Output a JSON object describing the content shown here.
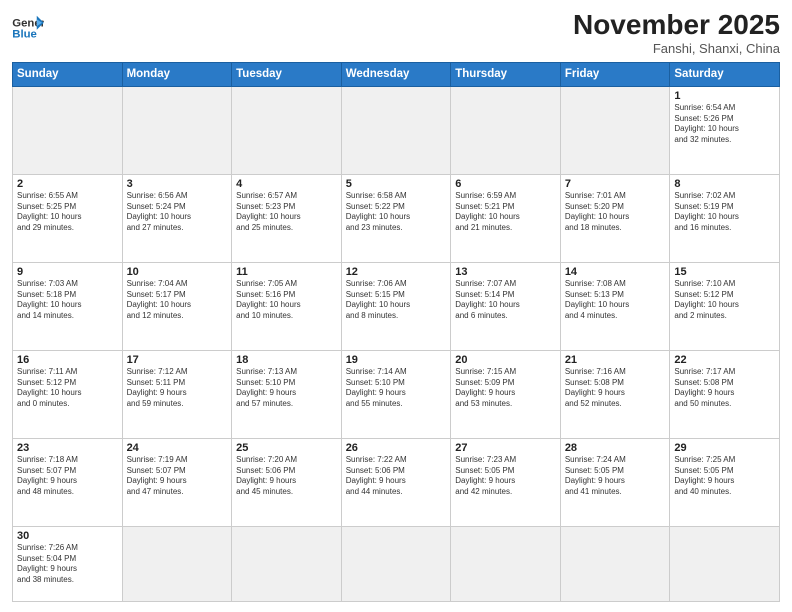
{
  "header": {
    "logo_general": "General",
    "logo_blue": "Blue",
    "month_title": "November 2025",
    "location": "Fanshi, Shanxi, China"
  },
  "weekdays": [
    "Sunday",
    "Monday",
    "Tuesday",
    "Wednesday",
    "Thursday",
    "Friday",
    "Saturday"
  ],
  "weeks": [
    [
      {
        "day": "",
        "info": ""
      },
      {
        "day": "",
        "info": ""
      },
      {
        "day": "",
        "info": ""
      },
      {
        "day": "",
        "info": ""
      },
      {
        "day": "",
        "info": ""
      },
      {
        "day": "",
        "info": ""
      },
      {
        "day": "1",
        "info": "Sunrise: 6:54 AM\nSunset: 5:26 PM\nDaylight: 10 hours\nand 32 minutes."
      }
    ],
    [
      {
        "day": "2",
        "info": "Sunrise: 6:55 AM\nSunset: 5:25 PM\nDaylight: 10 hours\nand 29 minutes."
      },
      {
        "day": "3",
        "info": "Sunrise: 6:56 AM\nSunset: 5:24 PM\nDaylight: 10 hours\nand 27 minutes."
      },
      {
        "day": "4",
        "info": "Sunrise: 6:57 AM\nSunset: 5:23 PM\nDaylight: 10 hours\nand 25 minutes."
      },
      {
        "day": "5",
        "info": "Sunrise: 6:58 AM\nSunset: 5:22 PM\nDaylight: 10 hours\nand 23 minutes."
      },
      {
        "day": "6",
        "info": "Sunrise: 6:59 AM\nSunset: 5:21 PM\nDaylight: 10 hours\nand 21 minutes."
      },
      {
        "day": "7",
        "info": "Sunrise: 7:01 AM\nSunset: 5:20 PM\nDaylight: 10 hours\nand 18 minutes."
      },
      {
        "day": "8",
        "info": "Sunrise: 7:02 AM\nSunset: 5:19 PM\nDaylight: 10 hours\nand 16 minutes."
      }
    ],
    [
      {
        "day": "9",
        "info": "Sunrise: 7:03 AM\nSunset: 5:18 PM\nDaylight: 10 hours\nand 14 minutes."
      },
      {
        "day": "10",
        "info": "Sunrise: 7:04 AM\nSunset: 5:17 PM\nDaylight: 10 hours\nand 12 minutes."
      },
      {
        "day": "11",
        "info": "Sunrise: 7:05 AM\nSunset: 5:16 PM\nDaylight: 10 hours\nand 10 minutes."
      },
      {
        "day": "12",
        "info": "Sunrise: 7:06 AM\nSunset: 5:15 PM\nDaylight: 10 hours\nand 8 minutes."
      },
      {
        "day": "13",
        "info": "Sunrise: 7:07 AM\nSunset: 5:14 PM\nDaylight: 10 hours\nand 6 minutes."
      },
      {
        "day": "14",
        "info": "Sunrise: 7:08 AM\nSunset: 5:13 PM\nDaylight: 10 hours\nand 4 minutes."
      },
      {
        "day": "15",
        "info": "Sunrise: 7:10 AM\nSunset: 5:12 PM\nDaylight: 10 hours\nand 2 minutes."
      }
    ],
    [
      {
        "day": "16",
        "info": "Sunrise: 7:11 AM\nSunset: 5:12 PM\nDaylight: 10 hours\nand 0 minutes."
      },
      {
        "day": "17",
        "info": "Sunrise: 7:12 AM\nSunset: 5:11 PM\nDaylight: 9 hours\nand 59 minutes."
      },
      {
        "day": "18",
        "info": "Sunrise: 7:13 AM\nSunset: 5:10 PM\nDaylight: 9 hours\nand 57 minutes."
      },
      {
        "day": "19",
        "info": "Sunrise: 7:14 AM\nSunset: 5:10 PM\nDaylight: 9 hours\nand 55 minutes."
      },
      {
        "day": "20",
        "info": "Sunrise: 7:15 AM\nSunset: 5:09 PM\nDaylight: 9 hours\nand 53 minutes."
      },
      {
        "day": "21",
        "info": "Sunrise: 7:16 AM\nSunset: 5:08 PM\nDaylight: 9 hours\nand 52 minutes."
      },
      {
        "day": "22",
        "info": "Sunrise: 7:17 AM\nSunset: 5:08 PM\nDaylight: 9 hours\nand 50 minutes."
      }
    ],
    [
      {
        "day": "23",
        "info": "Sunrise: 7:18 AM\nSunset: 5:07 PM\nDaylight: 9 hours\nand 48 minutes."
      },
      {
        "day": "24",
        "info": "Sunrise: 7:19 AM\nSunset: 5:07 PM\nDaylight: 9 hours\nand 47 minutes."
      },
      {
        "day": "25",
        "info": "Sunrise: 7:20 AM\nSunset: 5:06 PM\nDaylight: 9 hours\nand 45 minutes."
      },
      {
        "day": "26",
        "info": "Sunrise: 7:22 AM\nSunset: 5:06 PM\nDaylight: 9 hours\nand 44 minutes."
      },
      {
        "day": "27",
        "info": "Sunrise: 7:23 AM\nSunset: 5:05 PM\nDaylight: 9 hours\nand 42 minutes."
      },
      {
        "day": "28",
        "info": "Sunrise: 7:24 AM\nSunset: 5:05 PM\nDaylight: 9 hours\nand 41 minutes."
      },
      {
        "day": "29",
        "info": "Sunrise: 7:25 AM\nSunset: 5:05 PM\nDaylight: 9 hours\nand 40 minutes."
      }
    ],
    [
      {
        "day": "30",
        "info": "Sunrise: 7:26 AM\nSunset: 5:04 PM\nDaylight: 9 hours\nand 38 minutes."
      },
      {
        "day": "",
        "info": ""
      },
      {
        "day": "",
        "info": ""
      },
      {
        "day": "",
        "info": ""
      },
      {
        "day": "",
        "info": ""
      },
      {
        "day": "",
        "info": ""
      },
      {
        "day": "",
        "info": ""
      }
    ]
  ]
}
